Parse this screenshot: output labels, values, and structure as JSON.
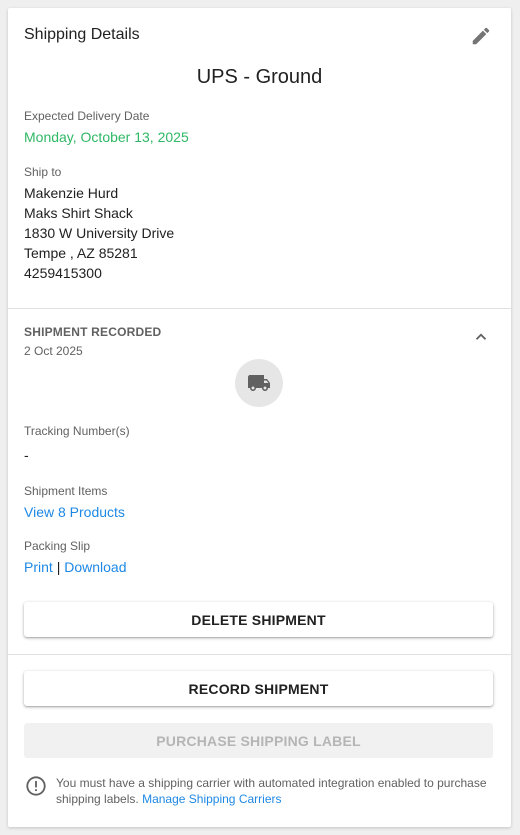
{
  "card": {
    "title": "Shipping Details",
    "edit_icon": "pencil-icon"
  },
  "shipping_method": "UPS - Ground",
  "delivery": {
    "label": "Expected Delivery Date",
    "value": "Monday, October 13, 2025",
    "value_color": "#2fb866"
  },
  "ship_to": {
    "label": "Ship to",
    "name": "Makenzie Hurd",
    "company": "Maks Shirt Shack",
    "street": "1830 W University Drive",
    "city_line": "Tempe , AZ 85281",
    "phone": "4259415300"
  },
  "shipment": {
    "status": "SHIPMENT RECORDED",
    "date": "2 Oct 2025",
    "collapse_icon": "chevron-up-icon",
    "status_icon": "truck-icon",
    "tracking_label": "Tracking Number(s)",
    "tracking_value": "-",
    "items_label": "Shipment Items",
    "items_link": "View 8 Products",
    "packing_label": "Packing Slip",
    "print_link": "Print",
    "separator": "|",
    "download_link": "Download",
    "delete_button": "DELETE SHIPMENT"
  },
  "actions": {
    "record_button": "RECORD SHIPMENT",
    "purchase_button": "PURCHASE SHIPPING LABEL",
    "purchase_disabled": true
  },
  "notice": {
    "icon": "info-circle-icon",
    "text": "You must have a shipping carrier with automated integration enabled to purchase shipping labels.",
    "link": "Manage Shipping Carriers"
  },
  "colors": {
    "link": "#1e88e5",
    "background": "#efefef",
    "card": "#ffffff"
  }
}
